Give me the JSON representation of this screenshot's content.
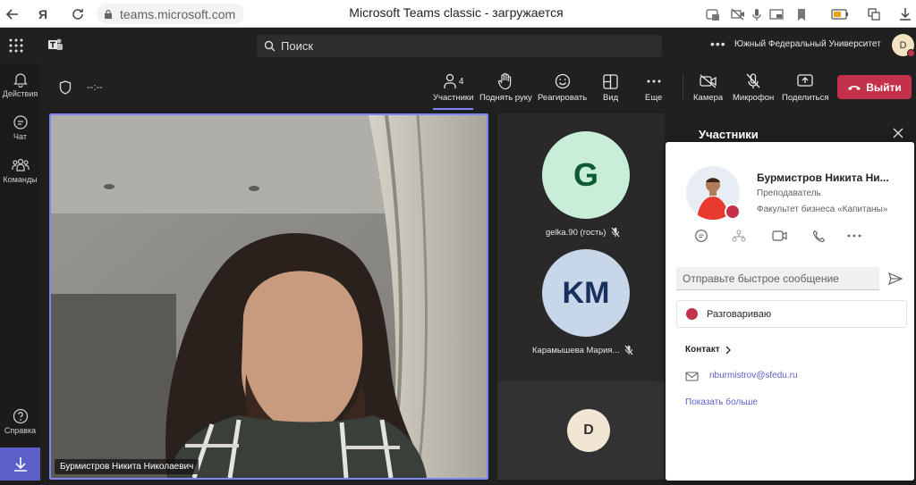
{
  "browser": {
    "url": "teams.microsoft.com",
    "title": "Microsoft Teams classic - загружается"
  },
  "teams_header": {
    "search_placeholder": "Поиск",
    "more": "•••",
    "organization": "Южный Федеральный Университет",
    "avatar_initial": "D"
  },
  "rail": {
    "items": [
      {
        "label": "Действия",
        "icon": "bell-icon"
      },
      {
        "label": "Чат",
        "icon": "chat-icon"
      },
      {
        "label": "Команды",
        "icon": "teams-icon"
      }
    ],
    "help": "Справка"
  },
  "meeting": {
    "timer": "--:--",
    "participants_count": "4",
    "buttons": {
      "participants": "Участники",
      "raise_hand": "Поднять руку",
      "react": "Реагировать",
      "view": "Вид",
      "more": "Еще",
      "camera": "Камера",
      "mic": "Микрофон",
      "share": "Поделиться",
      "leave": "Выйти"
    }
  },
  "video": {
    "main_name": "Бурмистров Никита Николаевич"
  },
  "tiles": [
    {
      "initials": "G",
      "name": "gelka.90 (гость)",
      "bg": "#c9eed8",
      "fg": "#0e5a32"
    },
    {
      "initials": "KM",
      "name": "Карамышева Мария...",
      "bg": "#c8d6ea",
      "fg": "#17305c"
    },
    {
      "initials": "D",
      "name": "",
      "bg": "#f1e6d3",
      "fg": "#333333"
    }
  ],
  "panel": {
    "title": "Участники"
  },
  "profile": {
    "name": "Бурмистров Никита Ни...",
    "role": "Преподаватель",
    "department": "Факультет бизнеса «Капитаны»",
    "message_placeholder": "Отправьте быстрое сообщение",
    "status": "Разговариваю",
    "contact_heading": "Контакт",
    "email": "nburmistrov@sfedu.ru",
    "show_more": "Показать больше"
  },
  "colors": {
    "accent": "#7f85f5",
    "leave": "#c4314b",
    "busy": "#c4314b",
    "link": "#5b5fc7"
  }
}
